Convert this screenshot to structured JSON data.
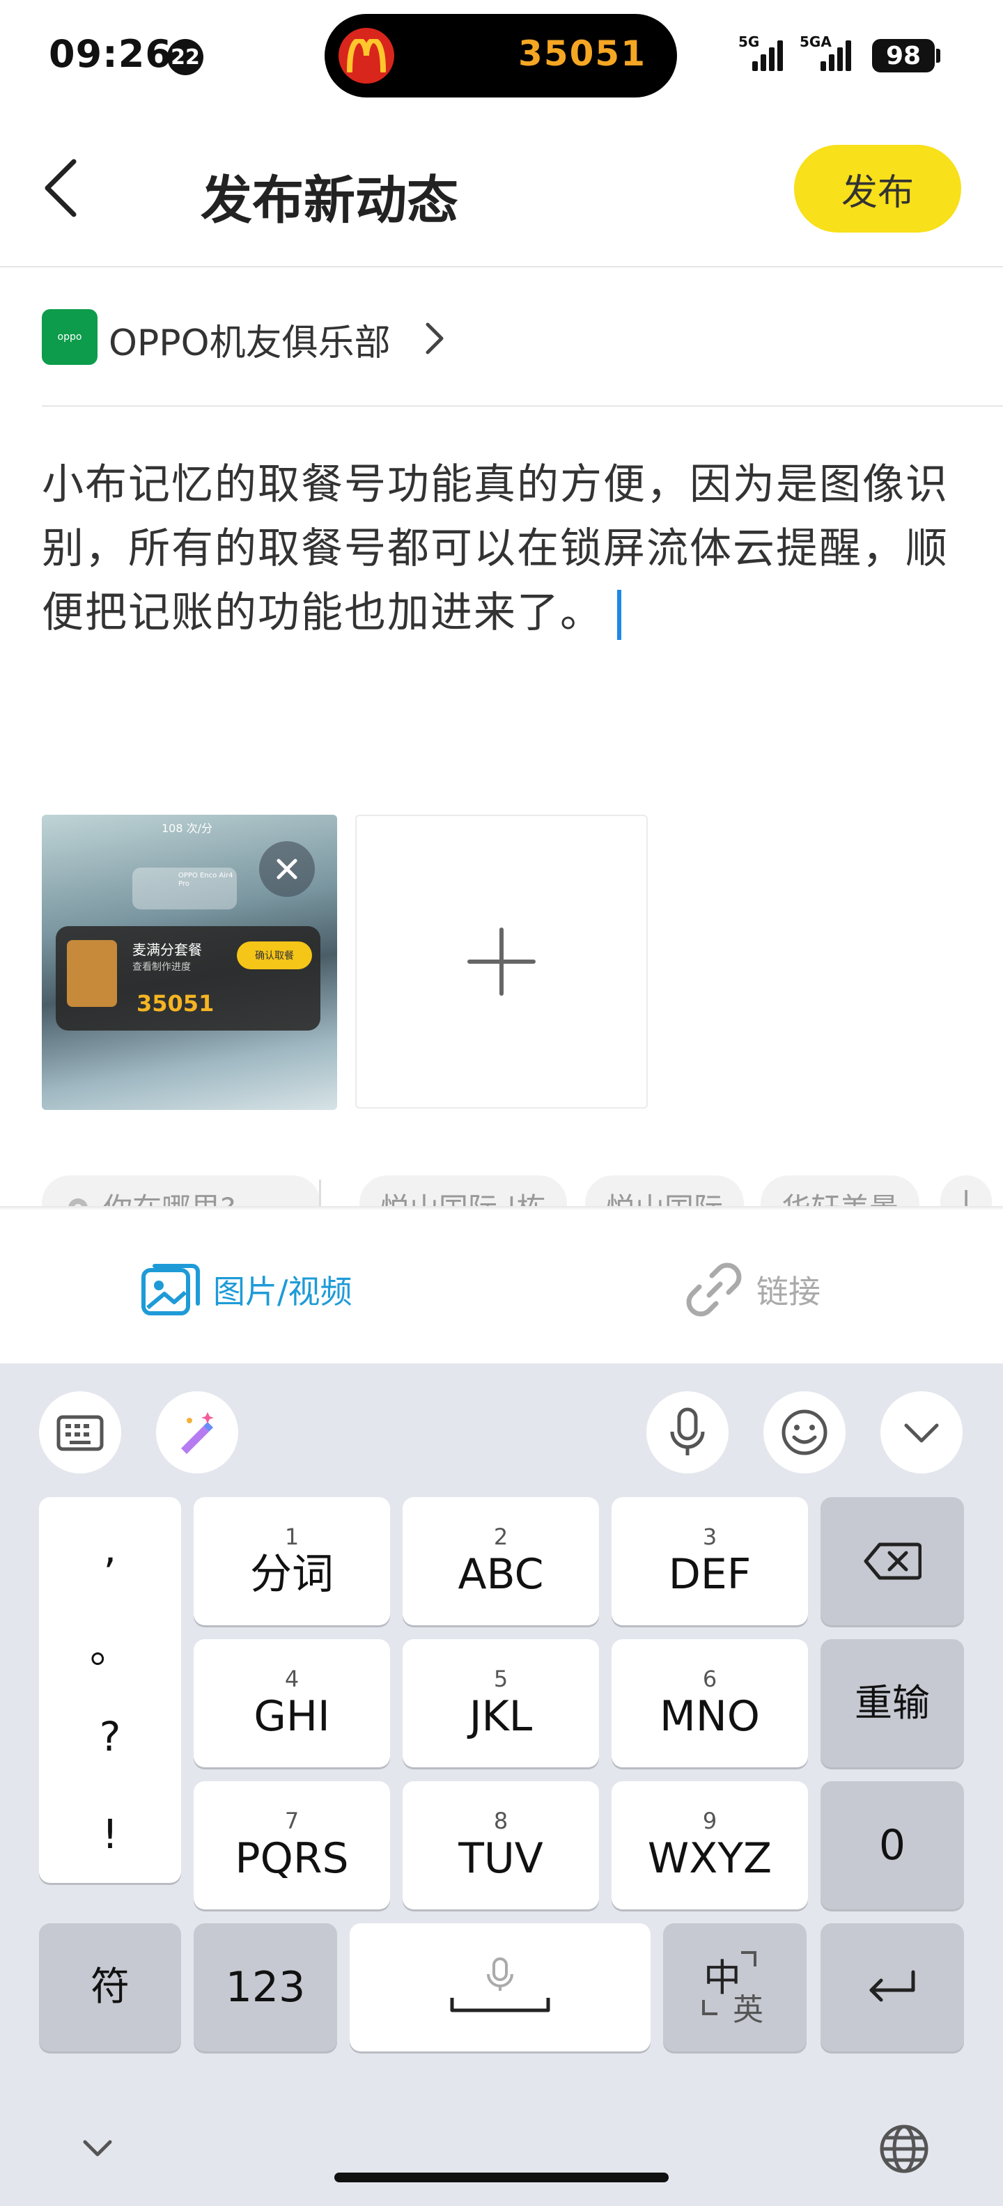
{
  "status_bar": {
    "time": "09:26",
    "notification_count": "22",
    "live_activity_number": "35051",
    "signal1_label": "5G",
    "signal2_label": "5GA",
    "battery": "98"
  },
  "header": {
    "title": "发布新动态",
    "publish_label": "发布"
  },
  "club": {
    "name": "OPPO机友俱乐部",
    "logo_text": "oppo"
  },
  "post": {
    "text": "小布记忆的取餐号功能真的方便，因为是图像识别，所有的取餐号都可以在锁屏流体云提醒，顺便把记账的功能也加进来了。"
  },
  "attachment": {
    "thumb_title": "麦满分套餐",
    "thumb_subtitle": "查看制作进度",
    "thumb_number": "35051",
    "thumb_pill": "确认取餐",
    "thumb_top_text": "108 次/分",
    "thumb_earbuds": "OPPO Enco Air4 Pro"
  },
  "locations": {
    "placeholder": "你在哪里?",
    "chips": [
      "悦山国际 |栋",
      "悦山国际",
      "华轩美景",
      "|"
    ]
  },
  "media_tabs": {
    "media_label": "图片/视频",
    "link_label": "链接"
  },
  "keyboard": {
    "punct": [
      ",",
      "。",
      "?",
      "!"
    ],
    "keys": [
      {
        "num": "1",
        "label": "分词"
      },
      {
        "num": "2",
        "label": "ABC"
      },
      {
        "num": "3",
        "label": "DEF"
      },
      {
        "num": "4",
        "label": "GHI"
      },
      {
        "num": "5",
        "label": "JKL"
      },
      {
        "num": "6",
        "label": "MNO"
      },
      {
        "num": "7",
        "label": "PQRS"
      },
      {
        "num": "8",
        "label": "TUV"
      },
      {
        "num": "9",
        "label": "WXYZ"
      }
    ],
    "reinput_label": "重输",
    "zero_label": "0",
    "symbol_label": "符",
    "numeric_label": "123",
    "lang_main": "中",
    "lang_sub": "英"
  },
  "colors": {
    "publish_bg": "#f8e01a",
    "accent_blue": "#1e9bd7",
    "club_green": "#0d9c4b",
    "keyboard_bg": "#e4e6ed"
  }
}
